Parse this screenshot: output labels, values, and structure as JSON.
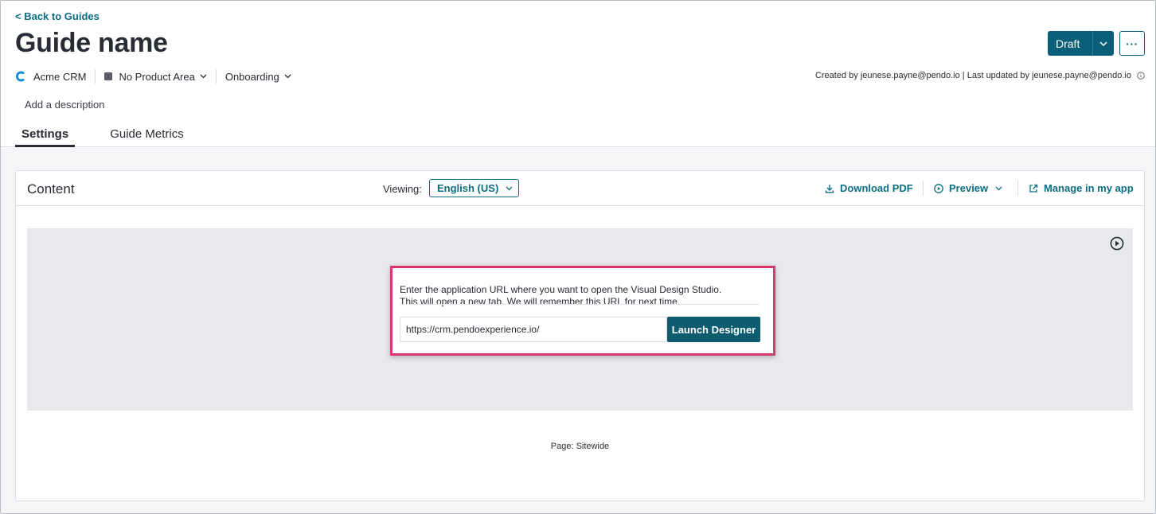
{
  "header": {
    "back_link": "< Back to Guides",
    "title": "Guide name",
    "status_button": "Draft",
    "more_button": "···",
    "app_name": "Acme CRM",
    "product_area": "No Product Area",
    "group": "Onboarding",
    "created_info": "Created by jeunese.payne@pendo.io | Last updated by jeunese.payne@pendo.io",
    "add_description": "Add a description",
    "tabs": [
      {
        "label": "Settings",
        "active": true
      },
      {
        "label": "Guide Metrics",
        "active": false
      }
    ]
  },
  "content": {
    "title": "Content",
    "viewing_label": "Viewing:",
    "language": "English (US)",
    "actions": {
      "download": "Download PDF",
      "preview": "Preview",
      "manage": "Manage in my app"
    },
    "designer": {
      "instruction_line1": "Enter the application URL where you want to open the Visual Design Studio.",
      "instruction_line2": "This will open a new tab. We will remember this URL for next time.",
      "url_value": "https://crm.pendoexperience.io/",
      "launch_button": "Launch Designer"
    },
    "page_label": "Page: Sitewide"
  },
  "colors": {
    "accent": "#0b6e83",
    "primary_button": "#0a5e78",
    "highlight": "#d63a6a",
    "preview_bg": "#e8e9ed"
  },
  "icons": [
    "app-logo-icon",
    "square-icon",
    "chevron-down-icon",
    "info-icon",
    "download-icon",
    "play-circle-icon",
    "external-link-icon"
  ]
}
